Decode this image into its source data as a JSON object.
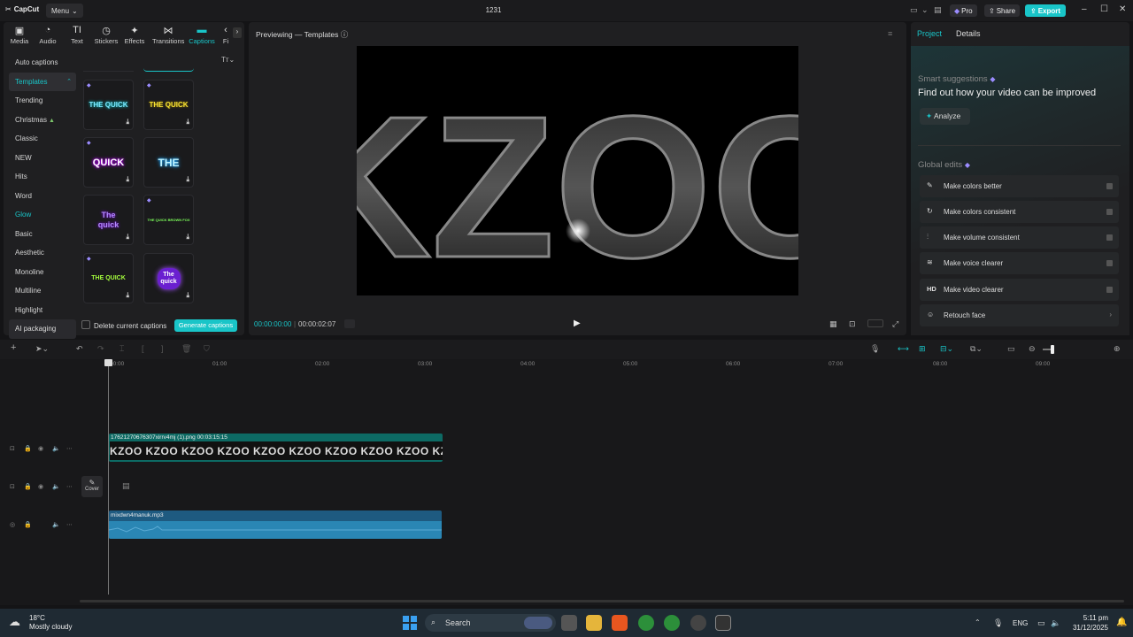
{
  "titlebar": {
    "app_name": "CapCut",
    "menu_label": "Menu",
    "project_title": "1231",
    "pro_label": "Pro",
    "share_label": "Share",
    "export_label": "Export"
  },
  "toolbar": {
    "tabs": [
      {
        "label": "Media",
        "icon": "media-icon"
      },
      {
        "label": "Audio",
        "icon": "audio-icon"
      },
      {
        "label": "Text",
        "icon": "text-icon"
      },
      {
        "label": "Stickers",
        "icon": "stickers-icon"
      },
      {
        "label": "Effects",
        "icon": "effects-icon"
      },
      {
        "label": "Transitions",
        "icon": "transitions-icon"
      },
      {
        "label": "Captions",
        "icon": "captions-icon"
      },
      {
        "label": "Fi",
        "icon": "filters-icon"
      }
    ],
    "active_tab": "Captions"
  },
  "captions": {
    "categories": [
      "Auto captions",
      "Templates",
      "Trending",
      "Christmas",
      "Classic",
      "NEW",
      "Hits",
      "Word",
      "Glow",
      "Basic",
      "Aesthetic",
      "Monoline",
      "Multiline",
      "Highlight",
      "AI packaging"
    ],
    "templates": [
      {
        "text": "THE QUICK",
        "color": "#7fe7ff"
      },
      {
        "text": "THE QUICK",
        "color": "#f5e234"
      },
      {
        "text": "QUICK",
        "color": "#ffffff"
      },
      {
        "text": "THE",
        "color": "#5ad7ff"
      },
      {
        "text": "The quick",
        "color": "#b48cff"
      },
      {
        "text": "THE QUICK BROWN FOX",
        "color": "#7dff5a"
      },
      {
        "text": "THE QUICK",
        "color": "#a6ff3d"
      },
      {
        "text": "The quick",
        "color": "#ffffff"
      }
    ],
    "delete_label": "Delete current captions",
    "generate_label": "Generate captions"
  },
  "preview": {
    "title": "Previewing — Templates",
    "video_text": "KZOO",
    "current_time": "00:00:00:00",
    "total_time": "00:00:02:07"
  },
  "right_panel": {
    "tabs": [
      "Project",
      "Details"
    ],
    "smart_title": "Smart suggestions",
    "smart_desc": "Find out how your video can be improved",
    "analyze_label": "Analyze",
    "global_title": "Global edits",
    "edits": [
      {
        "label": "Make colors better",
        "icon": "magic-wand-icon",
        "glyph": "✎"
      },
      {
        "label": "Make colors consistent",
        "icon": "color-match-icon",
        "glyph": "↻"
      },
      {
        "label": "Make volume consistent",
        "icon": "volume-levels-icon",
        "glyph": "⫶"
      },
      {
        "label": "Make voice clearer",
        "icon": "voice-enhance-icon",
        "glyph": "≋"
      },
      {
        "label": "Make video clearer",
        "icon": "hd-icon",
        "glyph": "HD"
      },
      {
        "label": "Retouch face",
        "icon": "retouch-face-icon",
        "glyph": "☺"
      }
    ]
  },
  "timeline": {
    "ticks": [
      "00:00",
      "01:00",
      "02:00",
      "03:00",
      "04:00",
      "05:00",
      "06:00",
      "07:00",
      "08:00",
      "09:00"
    ],
    "video_clip_label": "17621270676307xirrv4mj (1).png   00:03:15:15",
    "clip_frame_text": "KZOO KZOO KZOO KZOO KZOO KZOO KZOO KZOO KZOO KZOO KZOO K",
    "cover_label": "Cover",
    "audio_clip_label": "mixdwn4manuk.mp3"
  },
  "taskbar": {
    "temperature": "18°C",
    "weather": "Mostly cloudy",
    "search_label": "Search",
    "language": "ENG",
    "time": "5:11 pm",
    "date": "31/12/2025"
  }
}
